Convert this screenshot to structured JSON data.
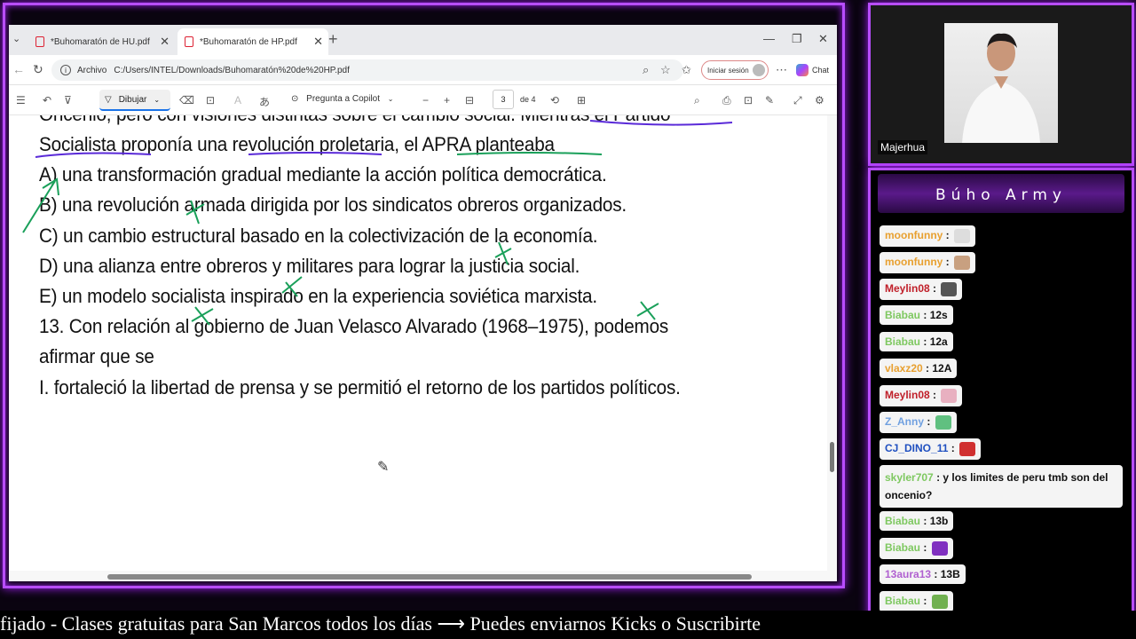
{
  "browser": {
    "tabs": [
      {
        "label": "*Buhomaratón de HU.pdf",
        "active": false
      },
      {
        "label": "*Buhomaratón de HP.pdf",
        "active": true
      }
    ],
    "address": {
      "scheme": "Archivo",
      "url": "C:/Users/INTEL/Downloads/Buhomaratón%20de%20HP.pdf"
    },
    "signin_label": "Iniciar sesión",
    "chat_label": "Chat"
  },
  "pdf_toolbar": {
    "draw_label": "Dibujar",
    "copilot_label": "Pregunta a Copilot",
    "page_current": "3",
    "page_total": "de 4"
  },
  "document": {
    "lines": [
      "Oncenio, pero con visiones distintas sobre el cambio social. Mientras el Partido",
      "Socialista proponía una revolución proletaria, el APRA planteaba",
      "A) una transformación gradual mediante la acción política democrática.",
      "B) una revolución armada dirigida por los sindicatos obreros organizados.",
      "C) un cambio estructural basado en la colectivización de la economía.",
      "D) una alianza entre obreros y militares para lograr la justicia social.",
      "E) un modelo socialista inspirado en la experiencia soviética marxista.",
      "13. Con relación al gobierno de Juan Velasco Alvarado (1968–1975), podemos",
      "afirmar que se",
      "I. fortaleció la libertad de prensa y se permitió el retorno de los partidos políticos."
    ]
  },
  "webcam": {
    "name": "Majerhua"
  },
  "chat": {
    "title": "Búho Army",
    "messages": [
      {
        "user": "moonfunny",
        "text": "",
        "emote": "hand-emote",
        "user_color": "#e8a030"
      },
      {
        "user": "moonfunny",
        "text": "",
        "emote": "cat-emote",
        "user_color": "#e8a030"
      },
      {
        "user": "Meylin08",
        "text": "",
        "emote": "person-emote",
        "user_color": "#c0202a"
      },
      {
        "user": "Biabau",
        "text": "12s",
        "emote": "",
        "user_color": "#7ec860"
      },
      {
        "user": "Biabau",
        "text": "12a",
        "emote": "",
        "user_color": "#7ec860"
      },
      {
        "user": "vlaxz20",
        "text": "12A",
        "emote": "",
        "user_color": "#e8a030"
      },
      {
        "user": "Meylin08",
        "text": "",
        "emote": "anime-emote",
        "user_color": "#c0202a"
      },
      {
        "user": "Z_Anny",
        "text": "",
        "emote": "frog-emote",
        "user_color": "#70a0e0"
      },
      {
        "user": "CJ_DINO_11",
        "text": "",
        "emote": "dino-emote",
        "user_color": "#2050c0"
      },
      {
        "user": "skyler707",
        "text": "y los limites de peru tmb son del oncenio?",
        "emote": "",
        "user_color": "#7ec860"
      },
      {
        "user": "Biabau",
        "text": "13b",
        "emote": "",
        "user_color": "#7ec860"
      },
      {
        "user": "Biabau",
        "text": "",
        "emote": "wizard-emote",
        "user_color": "#7ec860"
      },
      {
        "user": "13aura13",
        "text": "13B",
        "emote": "",
        "user_color": "#b060d0"
      },
      {
        "user": "Biabau",
        "text": "",
        "emote": "alien-emote",
        "user_color": "#7ec860"
      }
    ]
  },
  "ticker": {
    "text": "fijado  -  Clases gratuitas para San Marcos todos los días  ⟶  Puedes enviarnos Kicks o Suscribirte"
  },
  "colors": {
    "neon": "#b84dff",
    "ink_green": "#1aa05a",
    "ink_purple": "#5a2ad8"
  }
}
